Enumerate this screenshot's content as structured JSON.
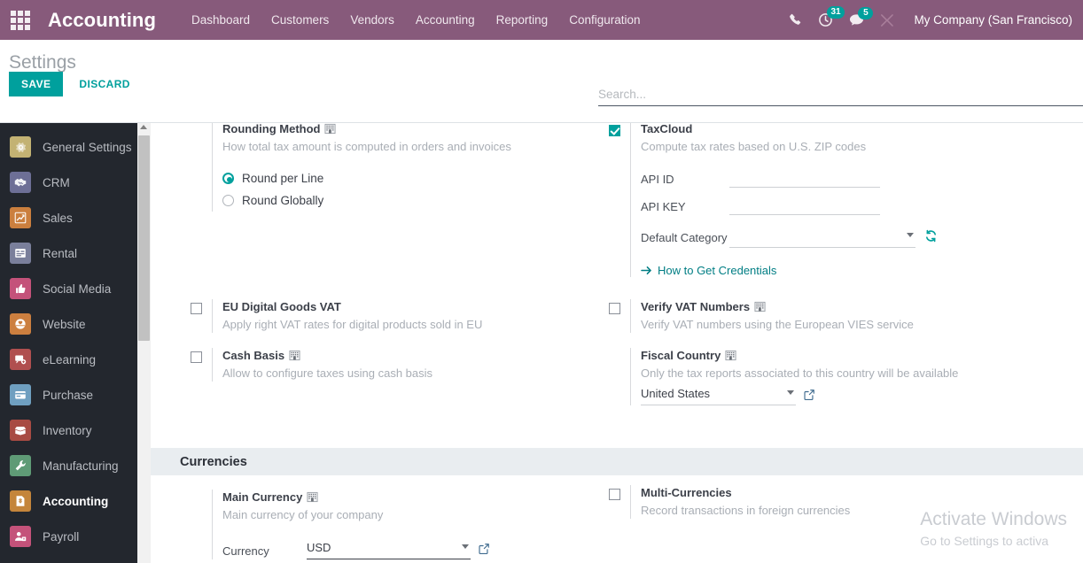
{
  "navbar": {
    "apps_icon": "apps-grid-icon",
    "brand": "Accounting",
    "menu": [
      {
        "label": "Dashboard"
      },
      {
        "label": "Customers"
      },
      {
        "label": "Vendors"
      },
      {
        "label": "Accounting"
      },
      {
        "label": "Reporting"
      },
      {
        "label": "Configuration"
      }
    ],
    "right": {
      "phone_icon": "phone-icon",
      "activities_icon": "clock-activity-icon",
      "activities_count": "31",
      "messages_icon": "chat-bubble-icon",
      "messages_count": "5",
      "tools_icon": "tools-wrench-icon",
      "company": "My Company (San Francisco)"
    },
    "brand_color": "#875a7b",
    "accent_color": "#00a09d"
  },
  "control_panel": {
    "title": "Settings",
    "save_label": "SAVE",
    "discard_label": "DISCARD",
    "search_placeholder": "Search...",
    "search_value": ""
  },
  "sidebar": {
    "items": [
      {
        "label": "General Settings",
        "icon": "gear-icon",
        "color": "#c3b273",
        "active": false
      },
      {
        "label": "CRM",
        "icon": "handshake-icon",
        "color": "#6d6f96",
        "active": false
      },
      {
        "label": "Sales",
        "icon": "chart-line-icon",
        "color": "#cb7f3e",
        "active": false
      },
      {
        "label": "Rental",
        "icon": "calendar-icon",
        "color": "#7a7f9b",
        "active": false
      },
      {
        "label": "Social Media",
        "icon": "thumbs-up-icon",
        "color": "#c4527a",
        "active": false
      },
      {
        "label": "Website",
        "icon": "globe-heart-icon",
        "color": "#cc7f3f",
        "active": false
      },
      {
        "label": "eLearning",
        "icon": "presentation-icon",
        "color": "#b04f4f",
        "active": false
      },
      {
        "label": "Purchase",
        "icon": "credit-card-icon",
        "color": "#6f9fc0",
        "active": false
      },
      {
        "label": "Inventory",
        "icon": "box-open-icon",
        "color": "#a84b43",
        "active": false
      },
      {
        "label": "Manufacturing",
        "icon": "wrench-icon",
        "color": "#5f9b76",
        "active": false
      },
      {
        "label": "Accounting",
        "icon": "invoice-dollar-icon",
        "color": "#c4853b",
        "active": true
      },
      {
        "label": "Payroll",
        "icon": "user-badge-icon",
        "color": "#c4527a",
        "active": false
      }
    ]
  },
  "taxes_section": {
    "rounding": {
      "title": "Rounding Method",
      "company_icon": "company-building-icon",
      "description": "How total tax amount is computed in orders and invoices",
      "options": [
        {
          "label": "Round per Line",
          "selected": true
        },
        {
          "label": "Round Globally",
          "selected": false
        }
      ]
    },
    "taxcloud": {
      "title": "TaxCloud",
      "description": "Compute tax rates based on U.S. ZIP codes",
      "checked": true,
      "fields": [
        {
          "label": "API ID",
          "value": "",
          "type": "text"
        },
        {
          "label": "API KEY",
          "value": "",
          "type": "text"
        },
        {
          "label": "Default Category",
          "value": "",
          "type": "select"
        }
      ],
      "refresh_icon": "refresh-sync-icon",
      "link_label": "How to Get Credentials",
      "link_icon": "arrow-right-icon"
    },
    "eu_digital_goods_vat": {
      "title": "EU Digital Goods VAT",
      "description": "Apply right VAT rates for digital products sold in EU",
      "checked": false
    },
    "cash_basis": {
      "title": "Cash Basis",
      "company_icon": "company-building-icon",
      "description": "Allow to configure taxes using cash basis",
      "checked": false
    },
    "verify_vat_numbers": {
      "title": "Verify VAT Numbers",
      "company_icon": "company-building-icon",
      "description": "Verify VAT numbers using the European VIES service",
      "checked": false
    },
    "fiscal_country": {
      "title": "Fiscal Country",
      "company_icon": "company-building-icon",
      "description": "Only the tax reports associated to this country will be available",
      "value": "United States",
      "external_link_icon": "external-link-icon"
    }
  },
  "currencies_section": {
    "band_title": "Currencies",
    "main_currency": {
      "title": "Main Currency",
      "company_icon": "company-building-icon",
      "description": "Main currency of your company",
      "field_label": "Currency",
      "value": "USD",
      "external_link_icon": "external-link-icon"
    },
    "multi_currencies": {
      "title": "Multi-Currencies",
      "description": "Record transactions in foreign currencies",
      "checked": false
    }
  },
  "watermark": {
    "line1": "Activate Windows",
    "line2": "Go to Settings to activa"
  }
}
